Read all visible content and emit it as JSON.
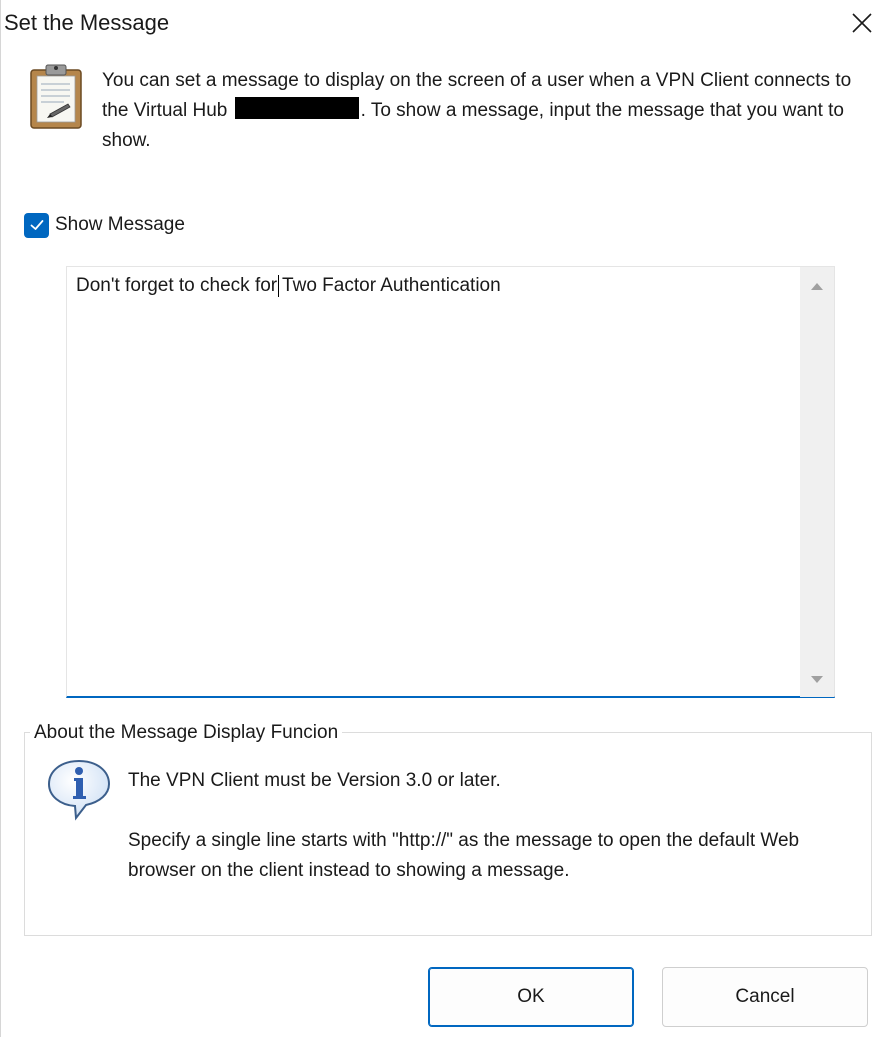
{
  "dialog": {
    "title": "Set the Message"
  },
  "intro": {
    "text_before": "You can set a message to display on the screen of a user when a VPN Client connects to the Virtual Hub",
    "text_after": ". To show a message, input the message that you want to show."
  },
  "show_message": {
    "label": "Show Message",
    "checked": true
  },
  "message": {
    "value": "Don't forget to check for Two Factor Authentication"
  },
  "about": {
    "title": "About the Message Display Funcion",
    "line1": "The VPN Client must be Version 3.0 or later.",
    "line2": "Specify a single line starts with \"http://\" as the message to open the default Web browser on the client instead to showing a message."
  },
  "buttons": {
    "ok": "OK",
    "cancel": "Cancel"
  },
  "colors": {
    "accent": "#0067c0"
  },
  "icons": {
    "close": "close-icon",
    "clipboard": "clipboard-icon",
    "info": "info-icon",
    "check": "checkmark-icon"
  }
}
